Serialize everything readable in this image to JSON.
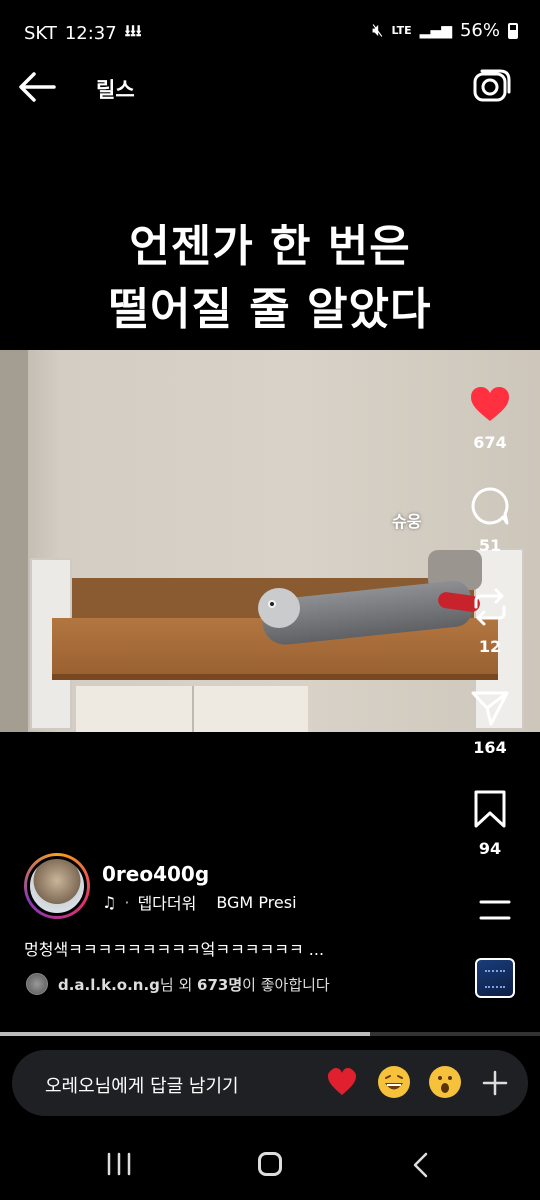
{
  "status_bar": {
    "carrier": "SKT",
    "time": "12:37",
    "network": "LTE",
    "battery": "56%"
  },
  "header": {
    "title": "릴스"
  },
  "caption": {
    "line1": "언젠가 한 번은",
    "line2": "떨어질 줄 알았다"
  },
  "video": {
    "overlay_text": "슈웅"
  },
  "actions": {
    "likes": "674",
    "comments": "51",
    "reposts": "12",
    "shares": "164",
    "saves": "94"
  },
  "post": {
    "username": "0reo400g",
    "music_title": "뎁다더워",
    "music_bgm": "BGM Presi",
    "description": "멍청색ㅋㅋㅋㅋㅋㅋㅋㅋㅋ엌ㅋㅋㅋㅋㅋㅋ ...",
    "liked_user": "d.a.l.k.o.n.g",
    "liked_mid": "님 외 ",
    "liked_count": "673명",
    "liked_suffix": "이 좋아합니다"
  },
  "progress": {
    "fraction": 0.685
  },
  "reply": {
    "placeholder": "오레오님에게 답글 남기기"
  },
  "colors": {
    "heart": "#ff3040",
    "background": "#000000"
  }
}
